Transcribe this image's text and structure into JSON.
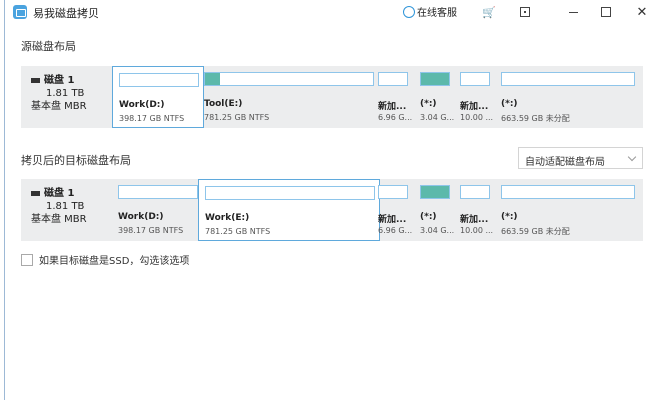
{
  "app": {
    "title": "易我磁盘拷贝",
    "support": "在线客服"
  },
  "window": {
    "close_glyph": "✕"
  },
  "source": {
    "title": "源磁盘布局",
    "disk": {
      "name": "磁盘 1",
      "size": "1.81 TB",
      "type": "基本盘 MBR"
    },
    "partitions": [
      {
        "label": "Work(D:)",
        "size": "398.17 GB NTFS",
        "used": 0,
        "selected": true
      },
      {
        "label": "Tool(E:)",
        "size": "781.25 GB NTFS",
        "used": 0.09,
        "selected": false
      },
      {
        "label": "新加...",
        "size": "6.96 G...",
        "used": 0,
        "selected": false
      },
      {
        "label": "(*:)",
        "size": "3.04 G...",
        "used": 1,
        "selected": false
      },
      {
        "label": "新加...",
        "size": "10.00 ...",
        "used": 0,
        "selected": false
      },
      {
        "label": "(*:)",
        "size": "663.59 GB 未分配",
        "used": 0,
        "selected": false
      }
    ]
  },
  "target": {
    "title": "拷贝后的目标磁盘布局",
    "layout_option": "自动适配磁盘布局",
    "disk": {
      "name": "磁盘 1",
      "size": "1.81 TB",
      "type": "基本盘 MBR"
    },
    "partitions": [
      {
        "label": "Work(D:)",
        "size": "398.17 GB NTFS",
        "used": 0,
        "selected": false
      },
      {
        "label": "Work(E:)",
        "size": "781.25 GB NTFS",
        "used": 0,
        "selected": true
      },
      {
        "label": "新加...",
        "size": "6.96 G...",
        "used": 0,
        "selected": false
      },
      {
        "label": "(*:)",
        "size": "3.04 G...",
        "used": 1,
        "selected": false
      },
      {
        "label": "新加...",
        "size": "10.00 ...",
        "used": 0,
        "selected": false
      },
      {
        "label": "(*:)",
        "size": "663.59 GB 未分配",
        "used": 0,
        "selected": false
      }
    ]
  },
  "ssd_option": {
    "label": "如果目标磁盘是SSD，勾选该选项",
    "checked": false
  },
  "colors": {
    "accent": "#4aa3df",
    "used_fill": "#5cb9ab",
    "panel_bg": "#ecedee"
  }
}
